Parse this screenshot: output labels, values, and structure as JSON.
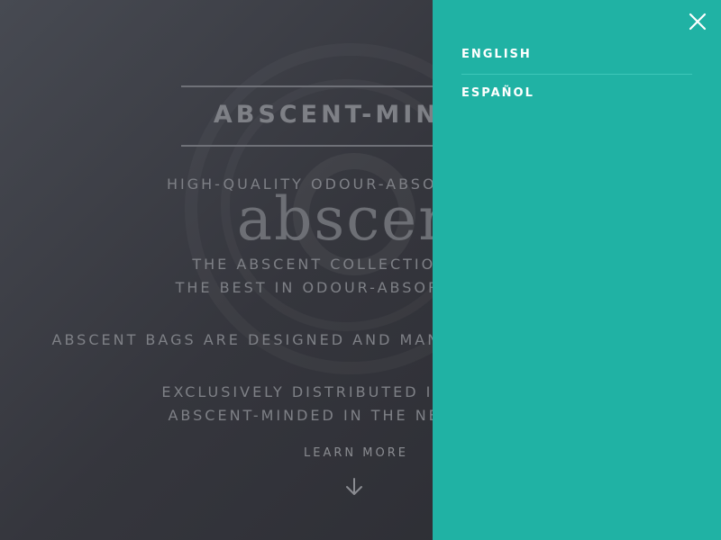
{
  "hero": {
    "brand_title": "ABSCENT-MINDED",
    "tagline": "HIGH-QUALITY ODOUR-ABSORBING BAGS",
    "logo_word": "abscent",
    "collection_line1": "THE ABSCENT COLLECTION OFFERS",
    "collection_line2": "THE BEST IN ODOUR-ABSORBING BAGS",
    "bags_line": "ABSCENT BAGS ARE DESIGNED AND MANUFACTURED IN THE USA",
    "distributed_line1": "EXCLUSIVELY DISTRIBUTED IN EUROPE BY",
    "distributed_line2": "ABSCENT-MINDED IN THE NETHERLANDS",
    "learn_more": "LEARN MORE",
    "arrow_icon": "arrow-down-icon"
  },
  "language_menu": {
    "close_icon": "close-icon",
    "items": [
      {
        "label": "ENGLISH"
      },
      {
        "label": "ESPAÑOL"
      }
    ],
    "background_color": "#20b2a4"
  }
}
